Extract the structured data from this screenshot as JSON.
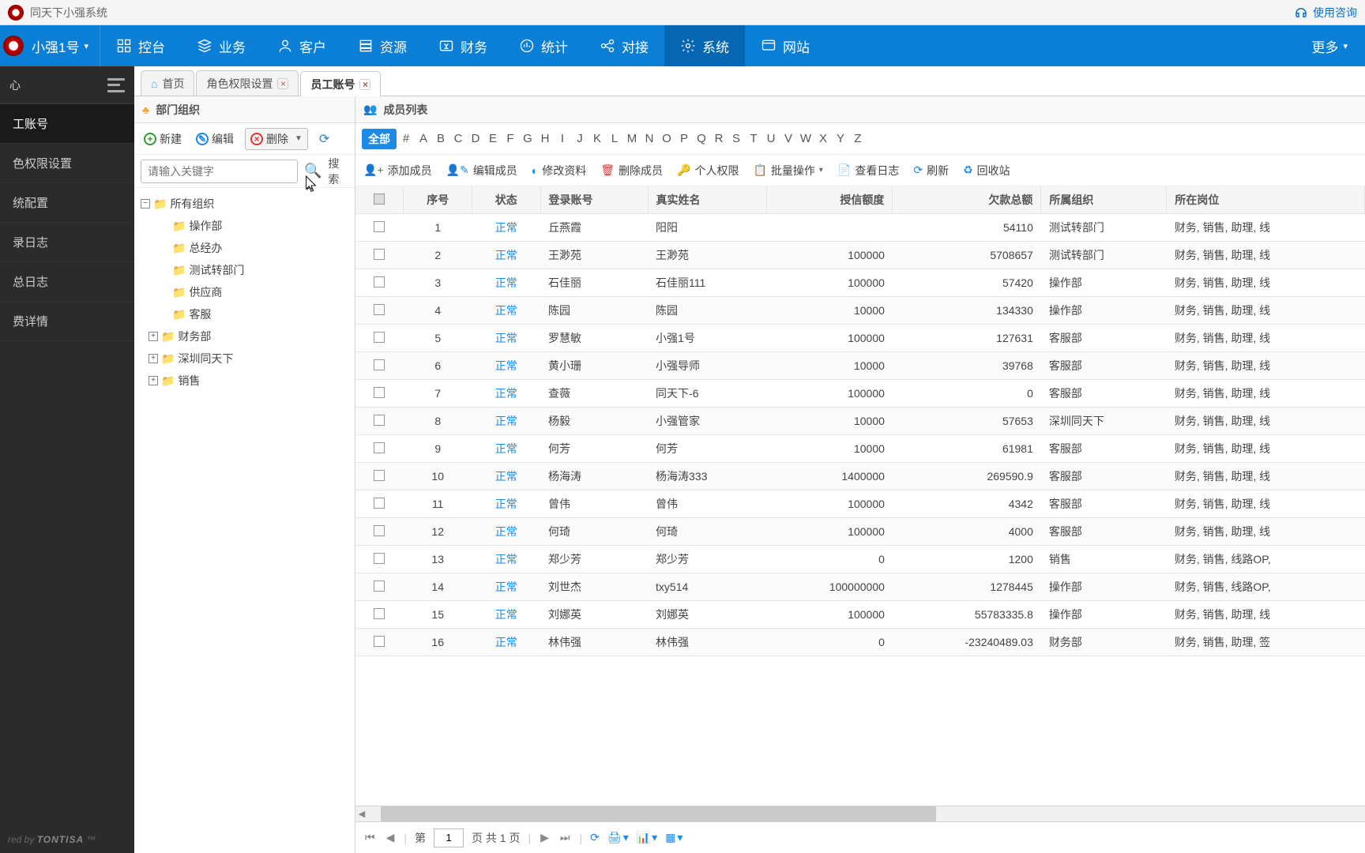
{
  "app": {
    "title": "同天下小强系统",
    "help": "使用咨询"
  },
  "brand": {
    "name": "小强1号"
  },
  "nav": {
    "items": [
      {
        "label": "控台"
      },
      {
        "label": "业务"
      },
      {
        "label": "客户"
      },
      {
        "label": "资源"
      },
      {
        "label": "财务"
      },
      {
        "label": "统计"
      },
      {
        "label": "对接"
      },
      {
        "label": "系统"
      },
      {
        "label": "网站"
      }
    ],
    "more": "更多"
  },
  "sidebar": {
    "group": "心",
    "items": [
      {
        "label": "工账号"
      },
      {
        "label": "色权限设置"
      },
      {
        "label": "统配置"
      },
      {
        "label": "录日志"
      },
      {
        "label": "总日志"
      },
      {
        "label": "费详情"
      }
    ],
    "powered_pre": "red by ",
    "powered": "TONTISA"
  },
  "tabs": {
    "home": "首页",
    "t1": "角色权限设置",
    "t2": "员工账号"
  },
  "tree": {
    "title": "部门组织",
    "new": "新建",
    "edit": "编辑",
    "del": "删除",
    "search_btn": "搜索",
    "search_placeholder": "请输入关键字",
    "root": "所有组织",
    "nodes": [
      {
        "label": "操作部",
        "exp": false
      },
      {
        "label": "总经办",
        "exp": false
      },
      {
        "label": "测试转部门",
        "exp": false
      },
      {
        "label": "供应商",
        "exp": false
      },
      {
        "label": "客服",
        "exp": false
      },
      {
        "label": "财务部",
        "exp": true
      },
      {
        "label": "深圳同天下",
        "exp": true
      },
      {
        "label": "销售",
        "exp": true
      }
    ]
  },
  "members": {
    "title": "成员列表",
    "all": "全部",
    "letters": [
      "#",
      "A",
      "B",
      "C",
      "D",
      "E",
      "F",
      "G",
      "H",
      "I",
      "J",
      "K",
      "L",
      "M",
      "N",
      "O",
      "P",
      "Q",
      "R",
      "S",
      "T",
      "U",
      "V",
      "W",
      "X",
      "Y",
      "Z"
    ],
    "tb": {
      "add": "添加成员",
      "edit": "编辑成员",
      "modify": "修改资料",
      "del": "删除成员",
      "perm": "个人权限",
      "batch": "批量操作",
      "log": "查看日志",
      "refresh": "刷新",
      "recycle": "回收站"
    },
    "cols": {
      "idx": "序号",
      "status": "状态",
      "account": "登录账号",
      "name": "真实姓名",
      "credit": "授信额度",
      "debt": "欠款总额",
      "org": "所属组织",
      "post": "所在岗位"
    },
    "rows": [
      {
        "idx": 1,
        "status": "正常",
        "account": "丘燕霞",
        "name": "阳阳",
        "credit": "",
        "debt": "54110",
        "org": "测试转部门",
        "post": "财务, 销售, 助理, 线"
      },
      {
        "idx": 2,
        "status": "正常",
        "account": "王渺苑",
        "name": "王渺苑",
        "credit": "100000",
        "debt": "5708657",
        "org": "测试转部门",
        "post": "财务, 销售, 助理, 线"
      },
      {
        "idx": 3,
        "status": "正常",
        "account": "石佳丽",
        "name": "石佳丽111",
        "credit": "100000",
        "debt": "57420",
        "org": "操作部",
        "post": "财务, 销售, 助理, 线"
      },
      {
        "idx": 4,
        "status": "正常",
        "account": "陈园",
        "name": "陈园",
        "credit": "10000",
        "debt": "134330",
        "org": "操作部",
        "post": "财务, 销售, 助理, 线"
      },
      {
        "idx": 5,
        "status": "正常",
        "account": "罗慧敏",
        "name": "小强1号",
        "credit": "100000",
        "debt": "127631",
        "org": "客服部",
        "post": "财务, 销售, 助理, 线"
      },
      {
        "idx": 6,
        "status": "正常",
        "account": "黄小珊",
        "name": "小强导师",
        "credit": "10000",
        "debt": "39768",
        "org": "客服部",
        "post": "财务, 销售, 助理, 线"
      },
      {
        "idx": 7,
        "status": "正常",
        "account": "查薇",
        "name": "同天下-6",
        "credit": "100000",
        "debt": "0",
        "org": "客服部",
        "post": "财务, 销售, 助理, 线"
      },
      {
        "idx": 8,
        "status": "正常",
        "account": "杨毅",
        "name": "小强管家",
        "credit": "10000",
        "debt": "57653",
        "org": "深圳同天下",
        "post": "财务, 销售, 助理, 线"
      },
      {
        "idx": 9,
        "status": "正常",
        "account": "何芳",
        "name": "何芳",
        "credit": "10000",
        "debt": "61981",
        "org": "客服部",
        "post": "财务, 销售, 助理, 线"
      },
      {
        "idx": 10,
        "status": "正常",
        "account": "杨海涛",
        "name": "杨海涛333",
        "credit": "1400000",
        "debt": "269590.9",
        "org": "客服部",
        "post": "财务, 销售, 助理, 线"
      },
      {
        "idx": 11,
        "status": "正常",
        "account": "曾伟",
        "name": "曾伟",
        "credit": "100000",
        "debt": "4342",
        "org": "客服部",
        "post": "财务, 销售, 助理, 线"
      },
      {
        "idx": 12,
        "status": "正常",
        "account": "何琦",
        "name": "何琦",
        "credit": "100000",
        "debt": "4000",
        "org": "客服部",
        "post": "财务, 销售, 助理, 线"
      },
      {
        "idx": 13,
        "status": "正常",
        "account": "郑少芳",
        "name": "郑少芳",
        "credit": "0",
        "debt": "1200",
        "org": "销售",
        "post": "财务, 销售, 线路OP,"
      },
      {
        "idx": 14,
        "status": "正常",
        "account": "刘世杰",
        "name": "txy514",
        "credit": "100000000",
        "debt": "1278445",
        "org": "操作部",
        "post": "财务, 销售, 线路OP,"
      },
      {
        "idx": 15,
        "status": "正常",
        "account": "刘娜英",
        "name": "刘娜英",
        "credit": "100000",
        "debt": "55783335.8",
        "org": "操作部",
        "post": "财务, 销售, 助理, 线"
      },
      {
        "idx": 16,
        "status": "正常",
        "account": "林伟强",
        "name": "林伟强",
        "credit": "0",
        "debt": "-23240489.03",
        "org": "财务部",
        "post": "财务, 销售, 助理, 签"
      }
    ]
  },
  "pager": {
    "pre": "第",
    "page": "1",
    "post": "页 共 1 页"
  }
}
